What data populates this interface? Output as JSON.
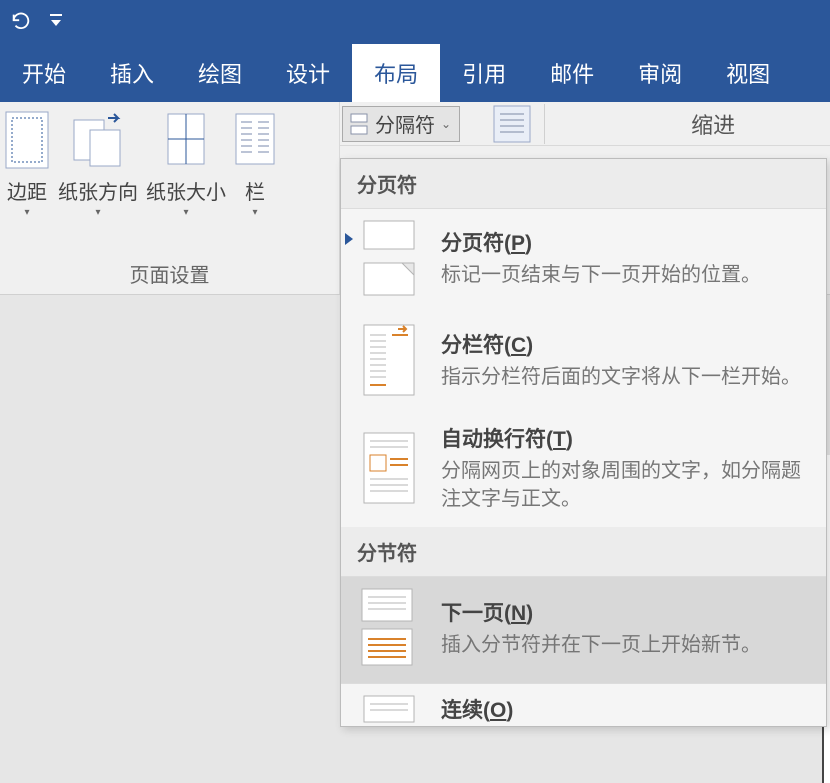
{
  "qat": {},
  "tabs": [
    {
      "label": "开始"
    },
    {
      "label": "插入"
    },
    {
      "label": "绘图"
    },
    {
      "label": "设计"
    },
    {
      "label": "布局",
      "active": true
    },
    {
      "label": "引用"
    },
    {
      "label": "邮件"
    },
    {
      "label": "审阅"
    },
    {
      "label": "视图"
    }
  ],
  "ribbon": {
    "pageSetup": {
      "groupLabel": "页面设置",
      "margins": "边距",
      "orientation": "纸张方向",
      "size": "纸张大小",
      "columns": "栏"
    },
    "breaksButton": "分隔符",
    "indentLabel": "缩进"
  },
  "dropdown": {
    "header_page": "分页符",
    "header_section": "分节符",
    "items": {
      "pageBreak": {
        "title": "分页符(",
        "accel": "P",
        "title_after": ")",
        "desc": "标记一页结束与下一页开始的位置。"
      },
      "columnBreak": {
        "title": "分栏符(",
        "accel": "C",
        "title_after": ")",
        "desc": "指示分栏符后面的文字将从下一栏开始。"
      },
      "textWrap": {
        "title": "自动换行符(",
        "accel": "T",
        "title_after": ")",
        "desc": "分隔网页上的对象周围的文字，如分隔题注文字与正文。"
      },
      "nextPage": {
        "title": "下一页(",
        "accel": "N",
        "title_after": ")",
        "desc": "插入分节符并在下一页上开始新节。"
      },
      "continuous": {
        "title": "连续(",
        "accel": "O",
        "title_after": ")",
        "desc": ""
      }
    }
  }
}
